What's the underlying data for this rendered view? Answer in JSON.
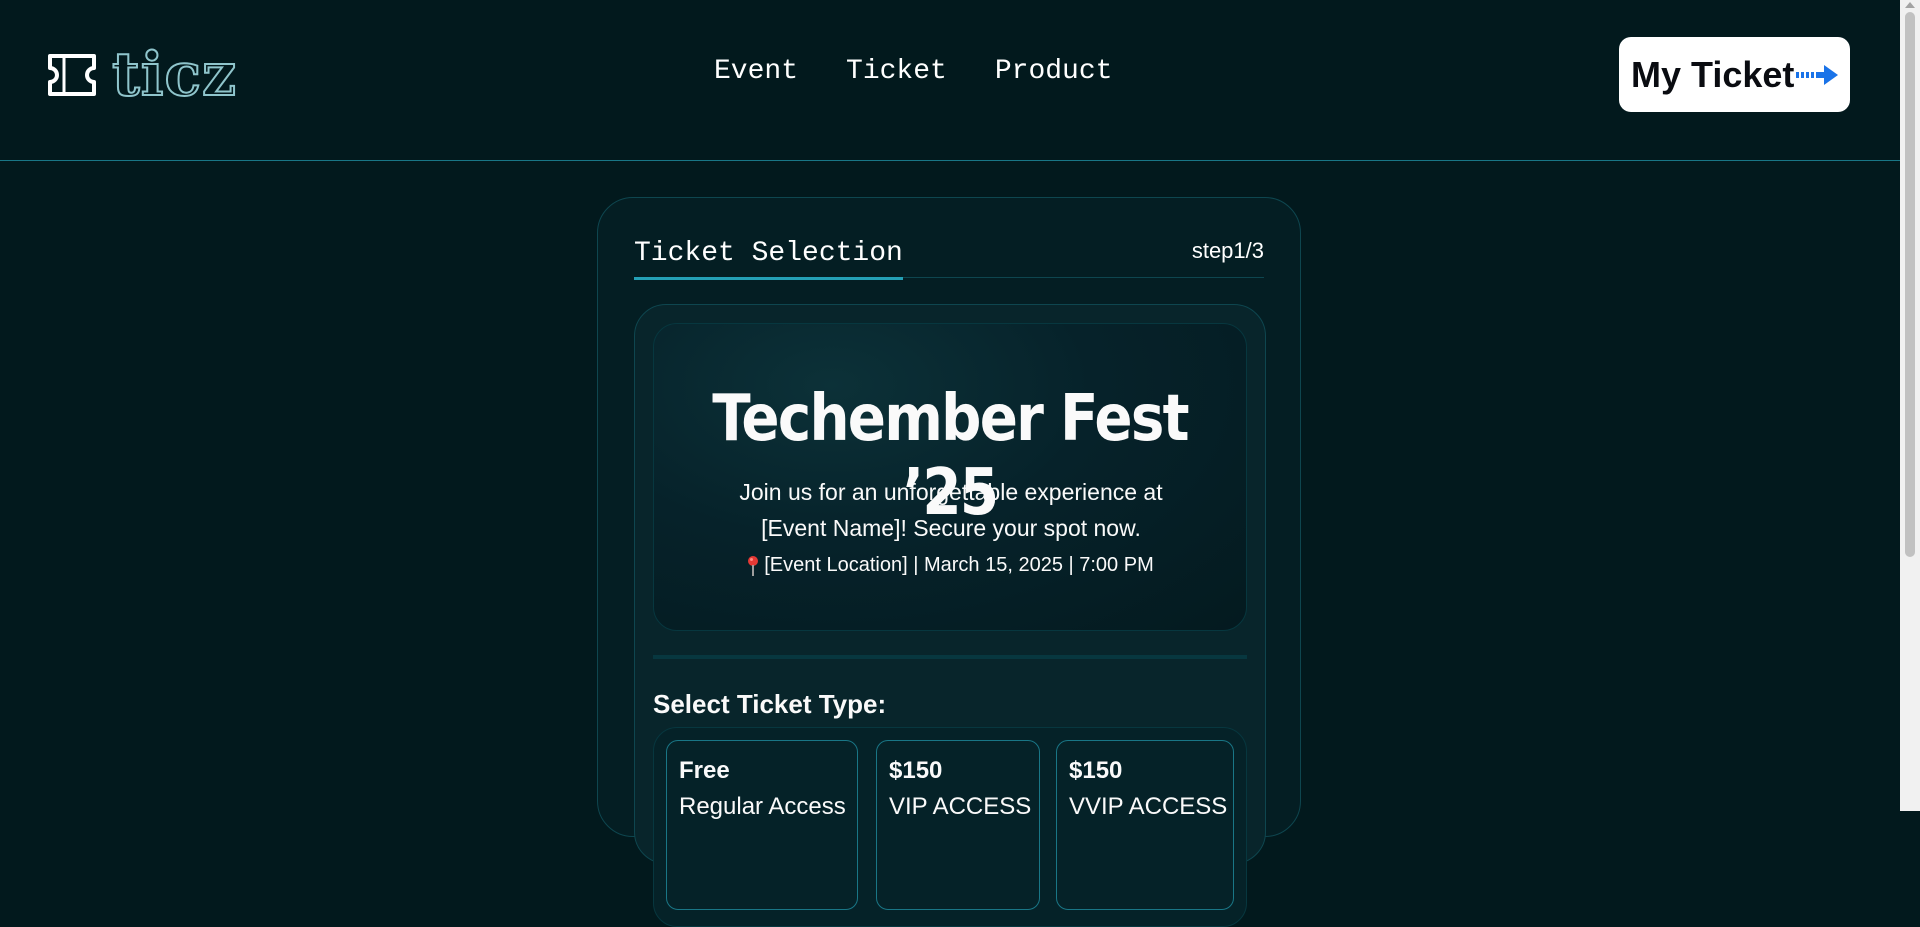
{
  "header": {
    "logo_text": "ticz",
    "nav": [
      "Event",
      "Ticket",
      "Product"
    ],
    "cta_label": "My Ticket",
    "cta_icon": "arrow-right-icon"
  },
  "card": {
    "title": "Ticket Selection",
    "step": "step1/3"
  },
  "event": {
    "title": "Techember Fest ’25",
    "description": "Join us for an unforgettable experience at [Event Name]! Secure your spot now.",
    "meta": "[Event Location] | March 15, 2025 | 7:00 PM",
    "meta_icon": "pin-icon"
  },
  "ticket_section": {
    "label": "Select Ticket Type:",
    "options": [
      {
        "price": "Free",
        "name": "Regular Access"
      },
      {
        "price": "$150",
        "name": "VIP ACCESS"
      },
      {
        "price": "$150",
        "name": "VVIP ACCESS"
      }
    ]
  },
  "colors": {
    "background": "#02191d",
    "accent": "#24a0b5",
    "border": "#0e464f",
    "cta_bg": "#ffffff",
    "arrow": "#1a73e8"
  }
}
